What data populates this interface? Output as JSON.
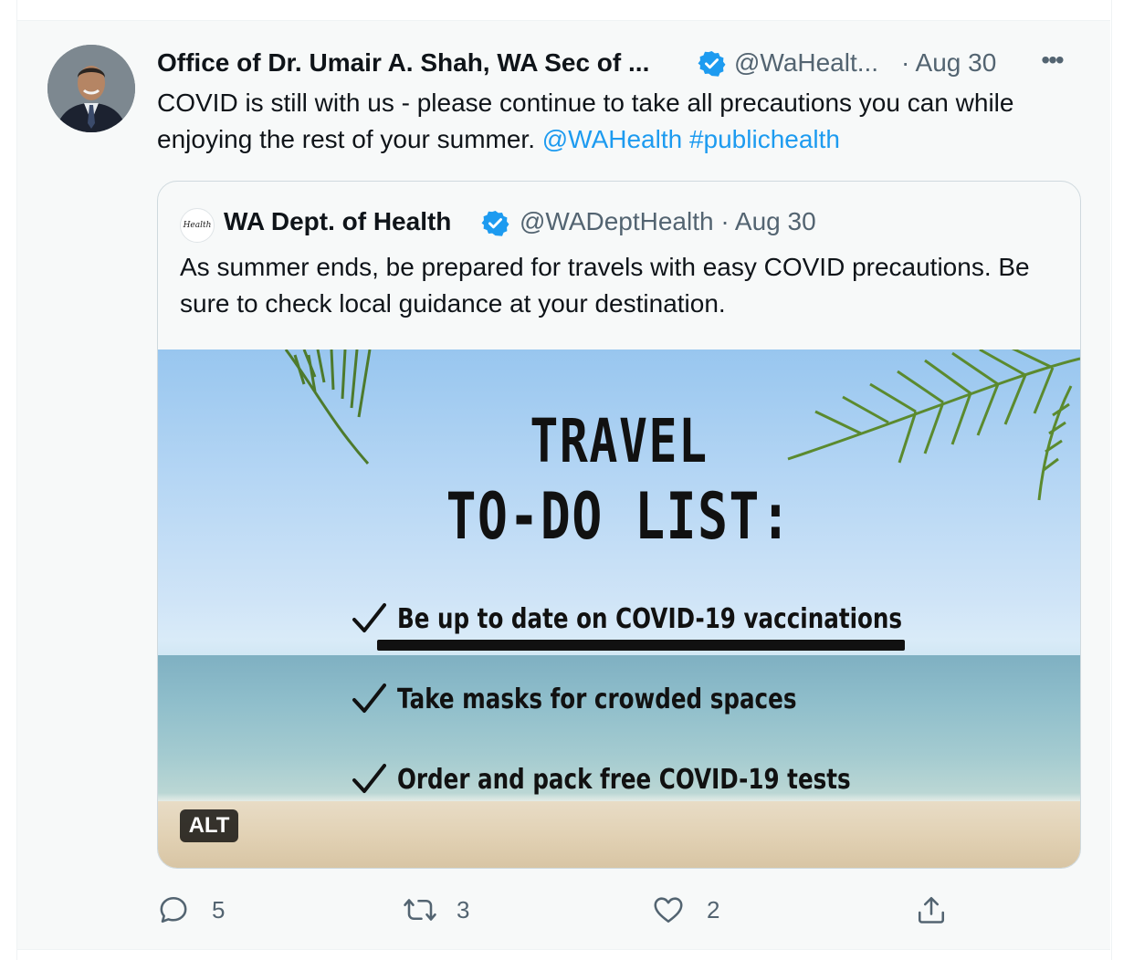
{
  "tweet": {
    "author_name": "Office of Dr. Umair A. Shah, WA Sec of ...",
    "author_handle": "@WaHealt...",
    "date": "· Aug 30",
    "more_label": "•••",
    "text_main": "COVID is still with us - please continue to take all precautions you can while enjoying the rest of your summer. ",
    "link_mention": "@WAHealth",
    "link_hashtag": "#publichealth",
    "verified_color": "#1d9bf0"
  },
  "quote": {
    "logo_text": "Health",
    "name": "WA Dept. of Health",
    "handle_date": "@WADeptHealth · Aug 30",
    "text": "As summer ends, be prepared for travels with easy COVID precautions. Be sure to check local guidance at your destination.",
    "media": {
      "title_line1": "TRAVEL",
      "title_line2": "TO-DO LIST:",
      "items": [
        "Be up to date on COVID-19 vaccinations",
        "Take masks for crowded spaces",
        "Order and pack free COVID-19 tests"
      ],
      "alt_label": "ALT"
    }
  },
  "actions": {
    "reply_count": "5",
    "retweet_count": "3",
    "like_count": "2",
    "share_count": ""
  }
}
